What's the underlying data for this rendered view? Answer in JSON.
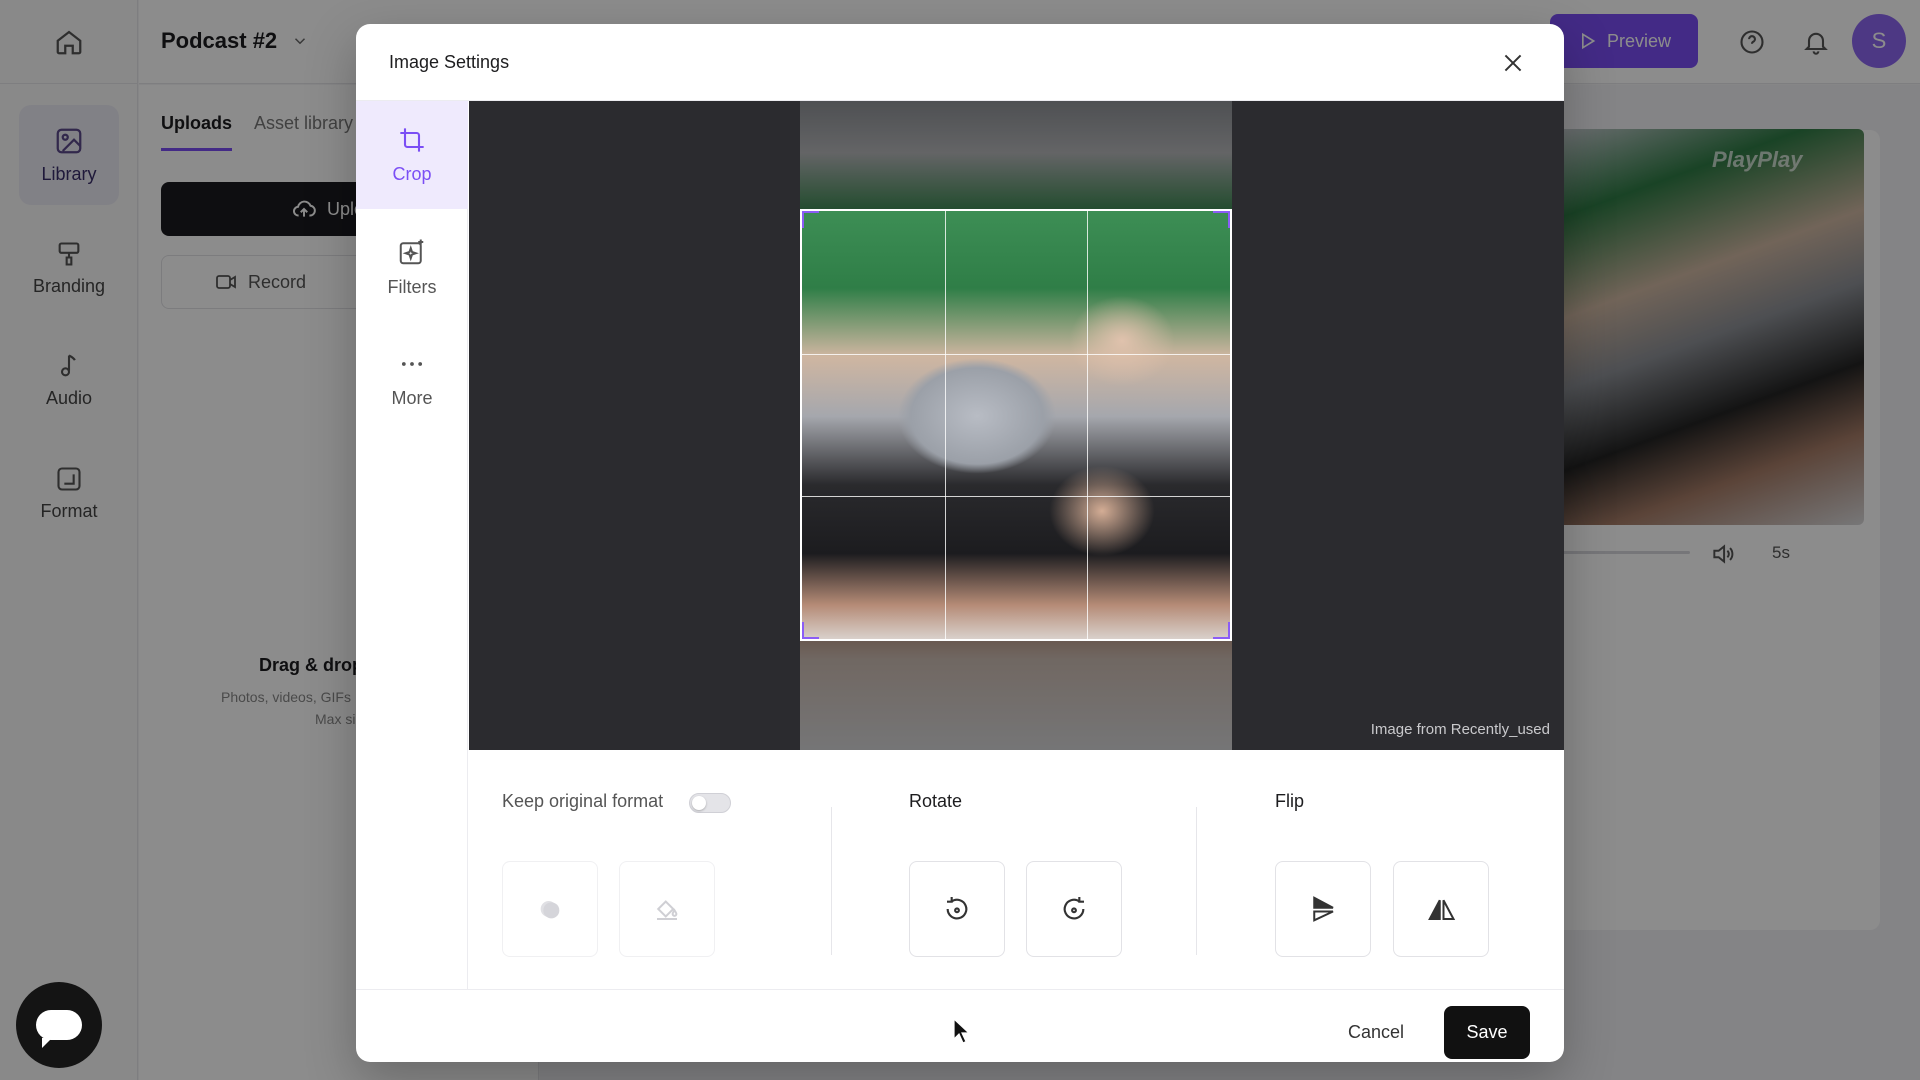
{
  "app": {
    "project_title": "Podcast #2",
    "preview_label": "Preview",
    "avatar_initial": "S",
    "nav": [
      {
        "label": "Library",
        "icon": "image-icon"
      },
      {
        "label": "Branding",
        "icon": "brush-icon"
      },
      {
        "label": "Audio",
        "icon": "music-note-icon"
      },
      {
        "label": "Format",
        "icon": "format-icon"
      }
    ],
    "library": {
      "tabs": [
        "Uploads",
        "Asset library"
      ],
      "upload_label": "Upload",
      "record_label": "Record",
      "drop_title": "Drag & drop",
      "drop_subtitle": "Photos, videos, GIFs",
      "drop_max": "Max size"
    },
    "preview": {
      "watermark": "PlayPlay",
      "duration": "5s"
    }
  },
  "modal": {
    "title": "Image Settings",
    "tools": [
      {
        "label": "Crop",
        "icon": "crop-icon",
        "active": true
      },
      {
        "label": "Filters",
        "icon": "sparkle-icon",
        "active": false
      },
      {
        "label": "More",
        "icon": "more-dots-icon",
        "active": false
      }
    ],
    "image_source": "Image from Recently_used",
    "keep_original_format": {
      "label": "Keep original format",
      "enabled": false
    },
    "rotate_label": "Rotate",
    "flip_label": "Flip",
    "cancel_label": "Cancel",
    "save_label": "Save"
  },
  "colors": {
    "accent": "#7b4ef5",
    "crop_handle": "#8b5cf6",
    "save_button": "#111111"
  }
}
